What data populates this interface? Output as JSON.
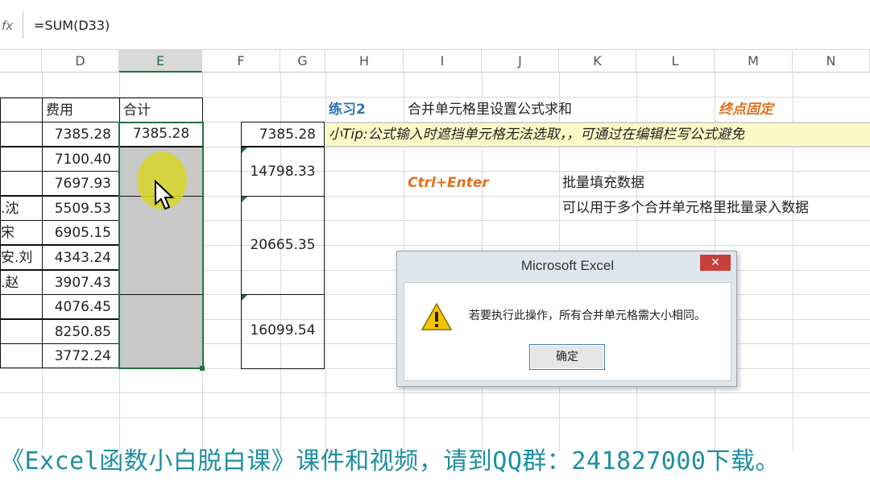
{
  "formula_bar": {
    "fx_label": "fx",
    "formula": "=SUM(D33)"
  },
  "columns": [
    "D",
    "E",
    "F",
    "G",
    "H",
    "I",
    "J",
    "K",
    "L",
    "M",
    "N"
  ],
  "selected_column": "E",
  "headers": {
    "fee": "费用",
    "total": "合计"
  },
  "row_labels": [
    "",
    "",
    "",
    ".沈",
    "宋",
    "安.刘",
    ".赵",
    "",
    "",
    ""
  ],
  "fees": [
    "7385.28",
    "7100.40",
    "7697.93",
    "5509.53",
    "6905.15",
    "4343.24",
    "3907.43",
    "4076.45",
    "8250.85",
    "3772.24"
  ],
  "total_first": "7385.28",
  "g_values": [
    "7385.28",
    "14798.33",
    "20665.35",
    "16099.54"
  ],
  "notes": {
    "exercise": "练习2",
    "exercise_desc": "合并单元格里设置公式求和",
    "endpoint": "终点固定",
    "tip": "小Tip:公式输入时遮挡单元格无法选取，，可通过在编辑栏写公式避免",
    "shortcut": "Ctrl+Enter",
    "shortcut_desc": "批量填充数据",
    "shortcut_desc2": "可以用于多个合并单元格里批量录入数据"
  },
  "dialog": {
    "title": "Microsoft Excel",
    "close": "✕",
    "message": "若要执行此操作，所有合并单元格需大小相同。",
    "ok": "确定"
  },
  "caption": "《Excel函数小白脱白课》课件和视频，请到QQ群：241827000下载。",
  "colors": {
    "accent_green": "#217346",
    "blue_note": "#2e74b5",
    "orange_note": "#e07020",
    "caption": "#1d8fa0"
  }
}
